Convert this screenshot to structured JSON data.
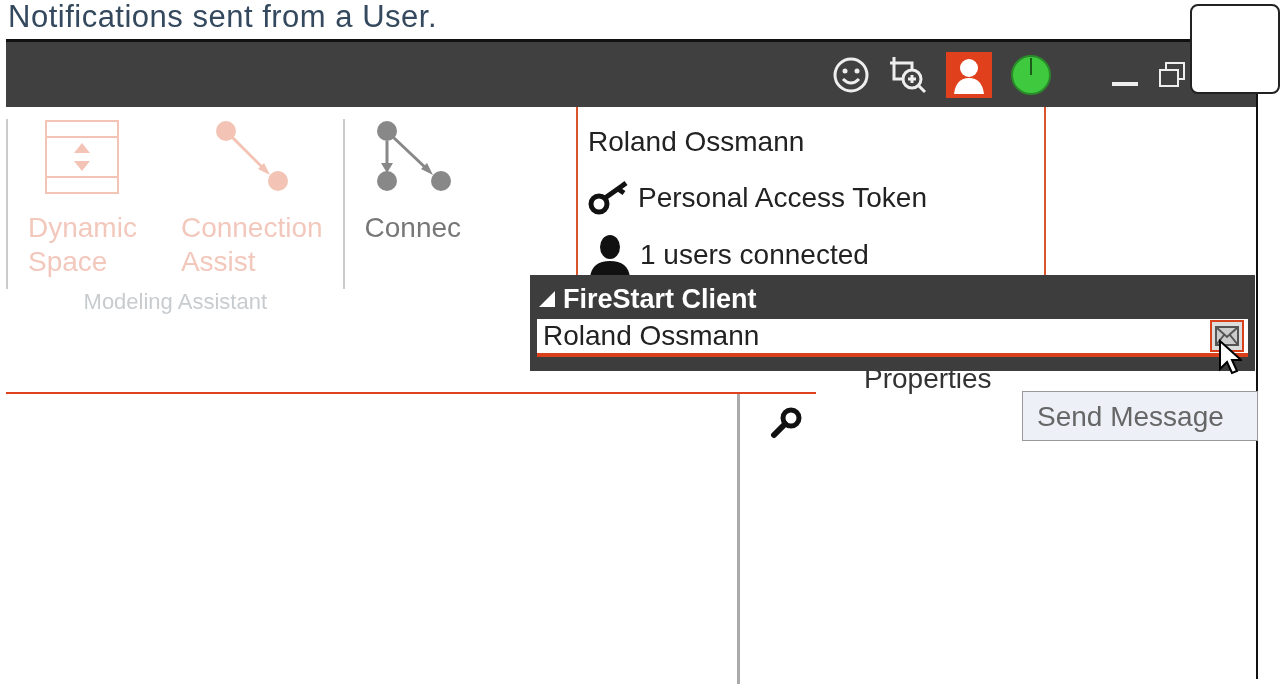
{
  "caption": "Notifications sent from a User.",
  "title_bar": {
    "user_menu_open": true
  },
  "ribbon": {
    "groups": [
      {
        "label": "Modeling Assistant",
        "disabled": true,
        "buttons": [
          {
            "kind": "dynamic-space",
            "lines": [
              "Dynamic",
              "Space"
            ]
          },
          {
            "kind": "connection-assist",
            "lines": [
              "Connection",
              "Assist"
            ]
          }
        ]
      },
      {
        "disabled": false,
        "buttons": [
          {
            "kind": "connect",
            "lines": [
              "Connec"
            ]
          }
        ]
      }
    ]
  },
  "properties_tab": "Properties",
  "user_menu": {
    "name": "Roland Ossmann",
    "items": [
      {
        "kind": "token",
        "label": "Personal Access Token"
      },
      {
        "kind": "users",
        "label": "1 users connected"
      }
    ]
  },
  "client_panel": {
    "title": "FireStart Client",
    "expanded": true,
    "users": [
      {
        "name": "Roland Ossmann"
      }
    ]
  },
  "tooltip": "Send Message"
}
